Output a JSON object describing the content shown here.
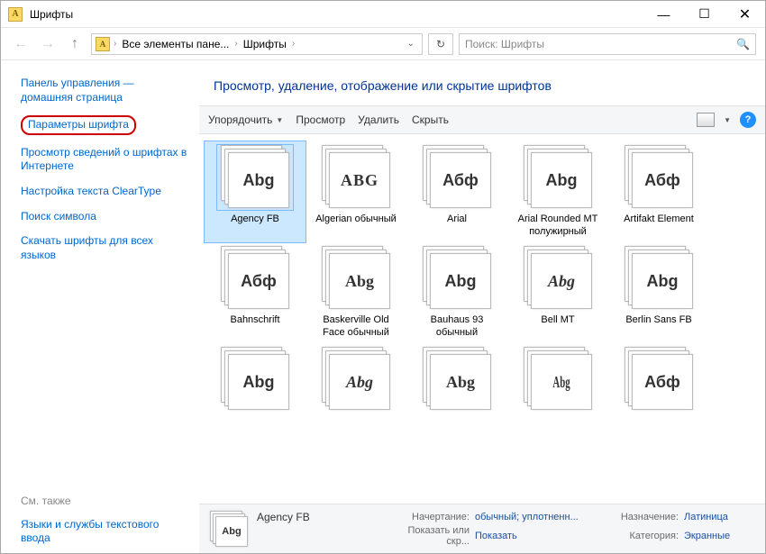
{
  "titlebar": {
    "title": "Шрифты"
  },
  "nav": {
    "crumb1": "Все элементы пане...",
    "crumb2": "Шрифты",
    "search_placeholder": "Поиск: Шрифты"
  },
  "sidebar": {
    "home": "Панель управления — домашняя страница",
    "params": "Параметры шрифта",
    "info": "Просмотр сведений о шрифтах в Интернете",
    "cleartype": "Настройка текста ClearType",
    "charmap": "Поиск символа",
    "download": "Скачать шрифты для всех языков",
    "seealso": "См. также",
    "textservices": "Языки и службы текстового ввода"
  },
  "heading": "Просмотр, удаление, отображение или скрытие шрифтов",
  "toolbar": {
    "organize": "Упорядочить",
    "preview": "Просмотр",
    "delete": "Удалить",
    "hide": "Скрыть"
  },
  "fonts": [
    {
      "label": "Agency FB",
      "glyph": "Abg",
      "style": "font-family:Arial Narrow,sans-serif;font-weight:bold"
    },
    {
      "label": "Algerian обычный",
      "glyph": "ABG",
      "style": "font-family:serif;letter-spacing:1px;font-weight:bold"
    },
    {
      "label": "Arial",
      "glyph": "Абф",
      "style": "font-family:Arial,sans-serif"
    },
    {
      "label": "Arial Rounded MT полужирный",
      "glyph": "Abg",
      "style": "font-family:Arial,sans-serif;font-weight:900"
    },
    {
      "label": "Artifakt Element",
      "glyph": "Абф",
      "style": "font-family:Arial,sans-serif"
    },
    {
      "label": "Bahnschrift",
      "glyph": "Абф",
      "style": "font-family:Arial,sans-serif"
    },
    {
      "label": "Baskerville Old Face обычный",
      "glyph": "Abg",
      "style": "font-family:Georgia,serif"
    },
    {
      "label": "Bauhaus 93 обычный",
      "glyph": "Abg",
      "style": "font-family:Arial Black,sans-serif;font-weight:900"
    },
    {
      "label": "Bell MT",
      "glyph": "Abg",
      "style": "font-family:Times New Roman,serif;font-style:italic"
    },
    {
      "label": "Berlin Sans FB",
      "glyph": "Abg",
      "style": "font-family:Arial,sans-serif;font-weight:bold"
    },
    {
      "label": "",
      "glyph": "Abg",
      "style": "font-family:Arial Black,sans-serif;font-weight:900"
    },
    {
      "label": "",
      "glyph": "Abg",
      "style": "font-family:cursive;font-style:italic"
    },
    {
      "label": "",
      "glyph": "Abg",
      "style": "font-family:Georgia,serif"
    },
    {
      "label": "",
      "glyph": "Abg",
      "style": "font-family:Times New Roman,serif;transform:scaleX(0.6)"
    },
    {
      "label": "",
      "glyph": "Абф",
      "style": "font-family:Arial,sans-serif"
    }
  ],
  "details": {
    "name": "Agency FB",
    "k_style": "Начертание:",
    "v_style": "обычный; уплотненн...",
    "k_purpose": "Назначение:",
    "v_purpose": "Латиница",
    "k_show": "Показать или скр...",
    "v_show": "Показать",
    "k_cat": "Категория:",
    "v_cat": "Экранные"
  }
}
